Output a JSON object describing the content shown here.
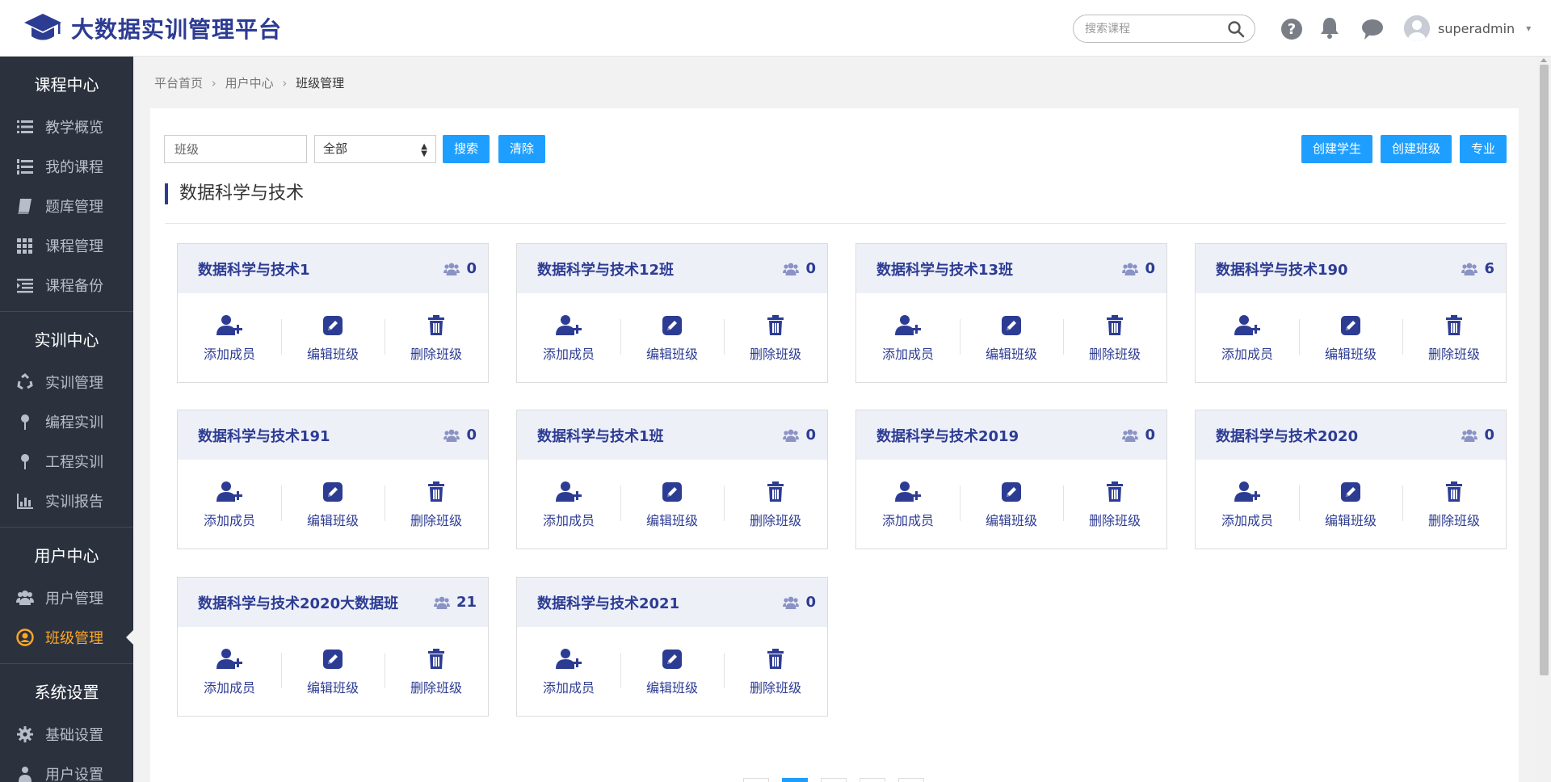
{
  "header": {
    "title": "大数据实训管理平台",
    "search_placeholder": "搜索课程",
    "username": "superadmin",
    "user_caret": "▾"
  },
  "sidebar": {
    "sections": [
      {
        "title": "课程中心",
        "items": [
          "教学概览",
          "我的课程",
          "题库管理",
          "课程管理",
          "课程备份"
        ]
      },
      {
        "title": "实训中心",
        "items": [
          "实训管理",
          "编程实训",
          "工程实训",
          "实训报告"
        ]
      },
      {
        "title": "用户中心",
        "items": [
          "用户管理",
          "班级管理"
        ]
      },
      {
        "title": "系统设置",
        "items": [
          "基础设置",
          "用户设置"
        ]
      }
    ],
    "active_item": "班级管理"
  },
  "breadcrumb": {
    "items": [
      "平台首页",
      "用户中心"
    ],
    "current": "班级管理",
    "separator": "›"
  },
  "toolbar": {
    "class_placeholder": "班级",
    "select_value": "全部",
    "search_label": "搜索",
    "clear_label": "清除",
    "create_student_label": "创建学生",
    "create_class_label": "创建班级",
    "major_label": "专业"
  },
  "section": {
    "title": "数据科学与技术"
  },
  "actions": {
    "add": "添加成员",
    "edit": "编辑班级",
    "delete": "删除班级"
  },
  "classes": [
    {
      "name": "数据科学与技术1",
      "count": "0"
    },
    {
      "name": "数据科学与技术12班",
      "count": "0"
    },
    {
      "name": "数据科学与技术13班",
      "count": "0"
    },
    {
      "name": "数据科学与技术190",
      "count": "6"
    },
    {
      "name": "数据科学与技术191",
      "count": "0"
    },
    {
      "name": "数据科学与技术1班",
      "count": "0"
    },
    {
      "name": "数据科学与技术2019",
      "count": "0"
    },
    {
      "name": "数据科学与技术2020",
      "count": "0"
    },
    {
      "name": "数据科学与技术2020大数据班",
      "count": "21"
    },
    {
      "name": "数据科学与技术2021",
      "count": "0"
    }
  ],
  "colors": {
    "brand": "#2d3c93",
    "button": "#1e9fff",
    "sidebar_bg": "#2b323e",
    "active": "#ffa726"
  }
}
